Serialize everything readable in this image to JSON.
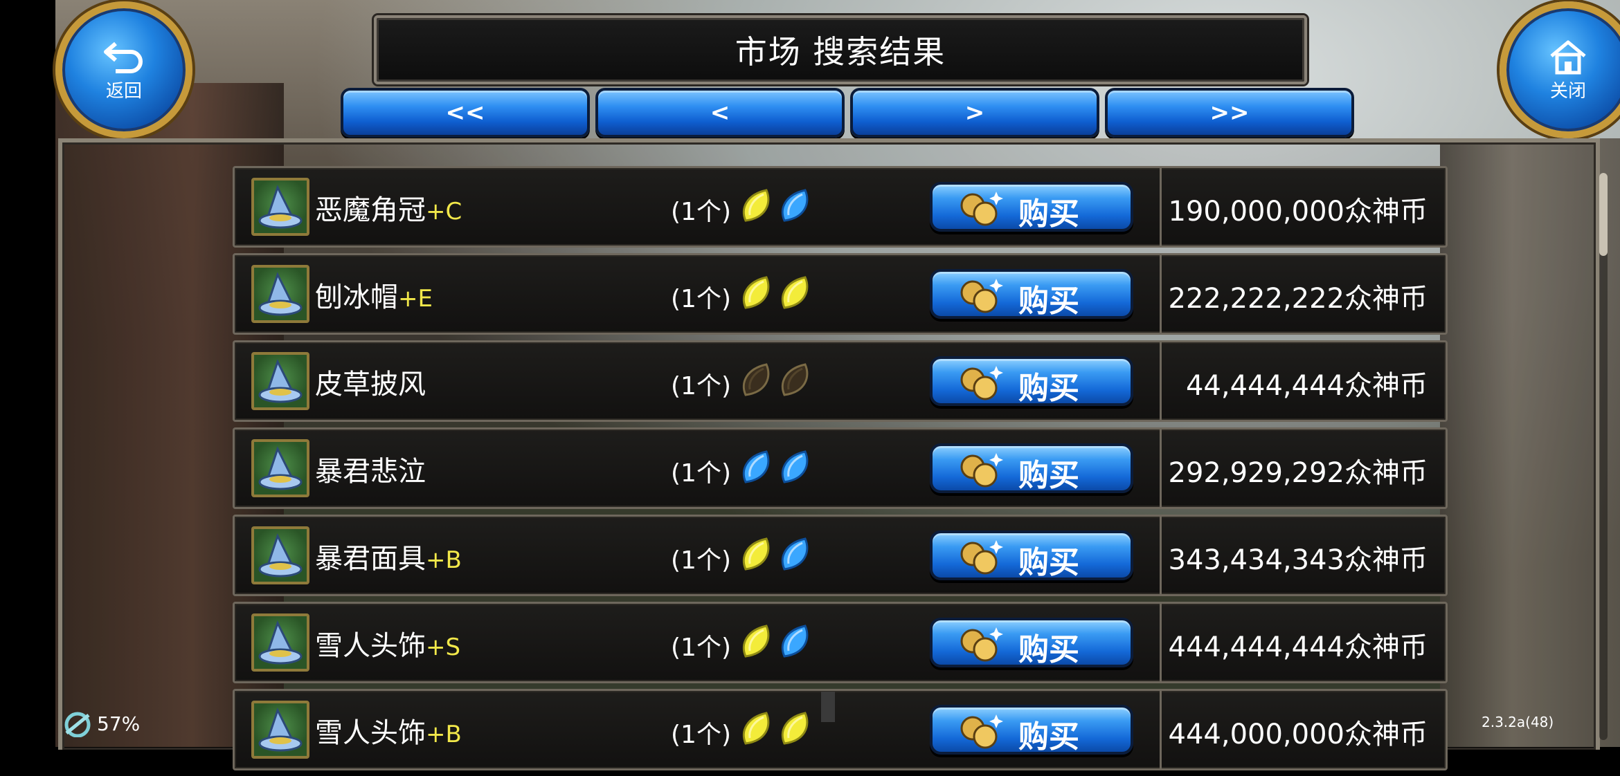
{
  "header": {
    "title": "市场 搜索结果"
  },
  "nav": {
    "first": "<<",
    "prev": "<",
    "next": ">",
    "last": ">>"
  },
  "back_button": {
    "label": "返回",
    "icon": "back-arrow-icon"
  },
  "close_button": {
    "label": "关闭",
    "icon": "home-icon"
  },
  "buy_label": "购买",
  "listings": [
    {
      "name": "恶魔角冠",
      "grade": "+C",
      "qty": "(1个)",
      "gems": [
        "yellow",
        "blue"
      ],
      "price": "190,000,000众神币"
    },
    {
      "name": "刨冰帽",
      "grade": "+E",
      "qty": "(1个)",
      "gems": [
        "yellow",
        "yellow"
      ],
      "price": "222,222,222众神币"
    },
    {
      "name": "皮草披风",
      "grade": "",
      "qty": "(1个)",
      "gems": [
        "empty",
        "empty"
      ],
      "price": "44,444,444众神币"
    },
    {
      "name": "暴君悲泣",
      "grade": "",
      "qty": "(1个)",
      "gems": [
        "blue",
        "blue"
      ],
      "price": "292,929,292众神币"
    },
    {
      "name": "暴君面具",
      "grade": "+B",
      "qty": "(1个)",
      "gems": [
        "yellow",
        "blue"
      ],
      "price": "343,434,343众神币"
    },
    {
      "name": "雪人头饰",
      "grade": "+S",
      "qty": "(1个)",
      "gems": [
        "yellow",
        "blue"
      ],
      "price": "444,444,444众神币"
    },
    {
      "name": "雪人头饰",
      "grade": "+B",
      "qty": "(1个)",
      "gems": [
        "yellow",
        "yellow"
      ],
      "price": "444,000,000众神币"
    }
  ],
  "status": {
    "battery": "57%",
    "version": "2.3.2a(48)"
  },
  "colors": {
    "accent_blue": "#1f82e0",
    "gold": "#c69a3a",
    "grade_yellow": "#f2e84a"
  }
}
